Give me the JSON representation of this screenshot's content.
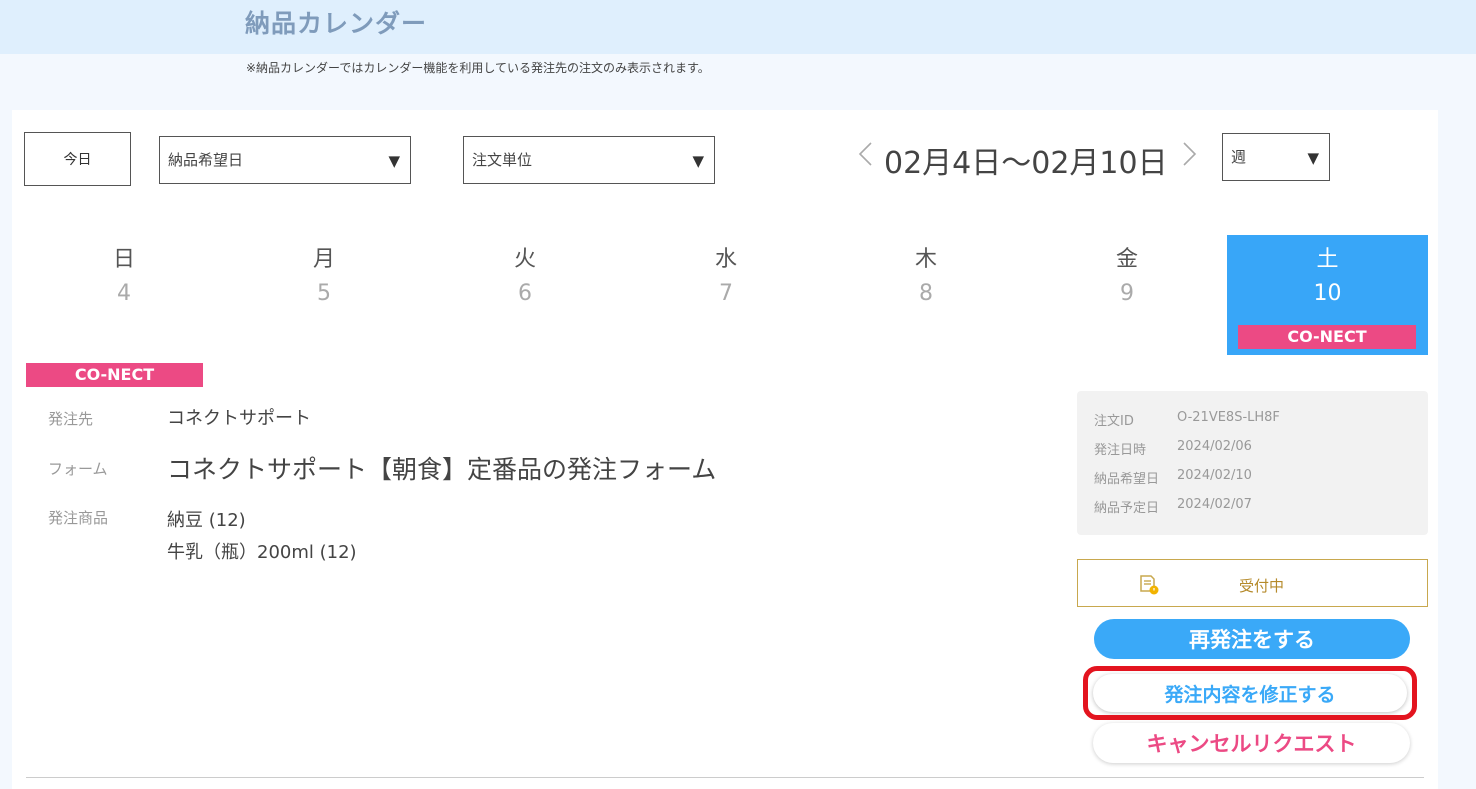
{
  "header": {
    "title": "納品カレンダー",
    "note": "※納品カレンダーではカレンダー機能を利用している発注先の注文のみ表示されます。"
  },
  "toolbar": {
    "today_label": "今日",
    "date_type_select": "納品希望日",
    "unit_select": "注文単位",
    "range_label": "02月4日～02月10日",
    "period_select": "週",
    "prev_icon": "chevron-left-icon",
    "next_icon": "chevron-right-icon"
  },
  "week": [
    {
      "name": "日",
      "num": "4"
    },
    {
      "name": "月",
      "num": "5"
    },
    {
      "name": "火",
      "num": "6"
    },
    {
      "name": "水",
      "num": "7"
    },
    {
      "name": "木",
      "num": "8"
    },
    {
      "name": "金",
      "num": "9"
    },
    {
      "name": "土",
      "num": "10",
      "tag": "CO-NECT",
      "selected": true
    }
  ],
  "order": {
    "tag": "CO-NECT",
    "supplier_label": "発注先",
    "supplier": "コネクトサポート",
    "form_label": "フォーム",
    "form": "コネクトサポート【朝食】定番品の発注フォーム",
    "items_label": "発注商品",
    "items": [
      "納豆 (12)",
      "牛乳（瓶）200ml (12)"
    ],
    "meta": [
      {
        "key": "注文ID",
        "value": "O-21VE8S-LH8F"
      },
      {
        "key": "発注日時",
        "value": "2024/02/06"
      },
      {
        "key": "納品希望日",
        "value": "2024/02/10"
      },
      {
        "key": "納品予定日",
        "value": "2024/02/07"
      }
    ],
    "status": "受付中",
    "status_icon": "document-clock-icon",
    "reorder_label": "再発注をする",
    "edit_label": "発注内容を修正する",
    "cancel_label": "キャンセルリクエスト"
  },
  "colors": {
    "accent": "#3aa9f8",
    "pink": "#ec4a84",
    "status_gold": "#b58a2a",
    "highlight_red": "#e3141f"
  }
}
